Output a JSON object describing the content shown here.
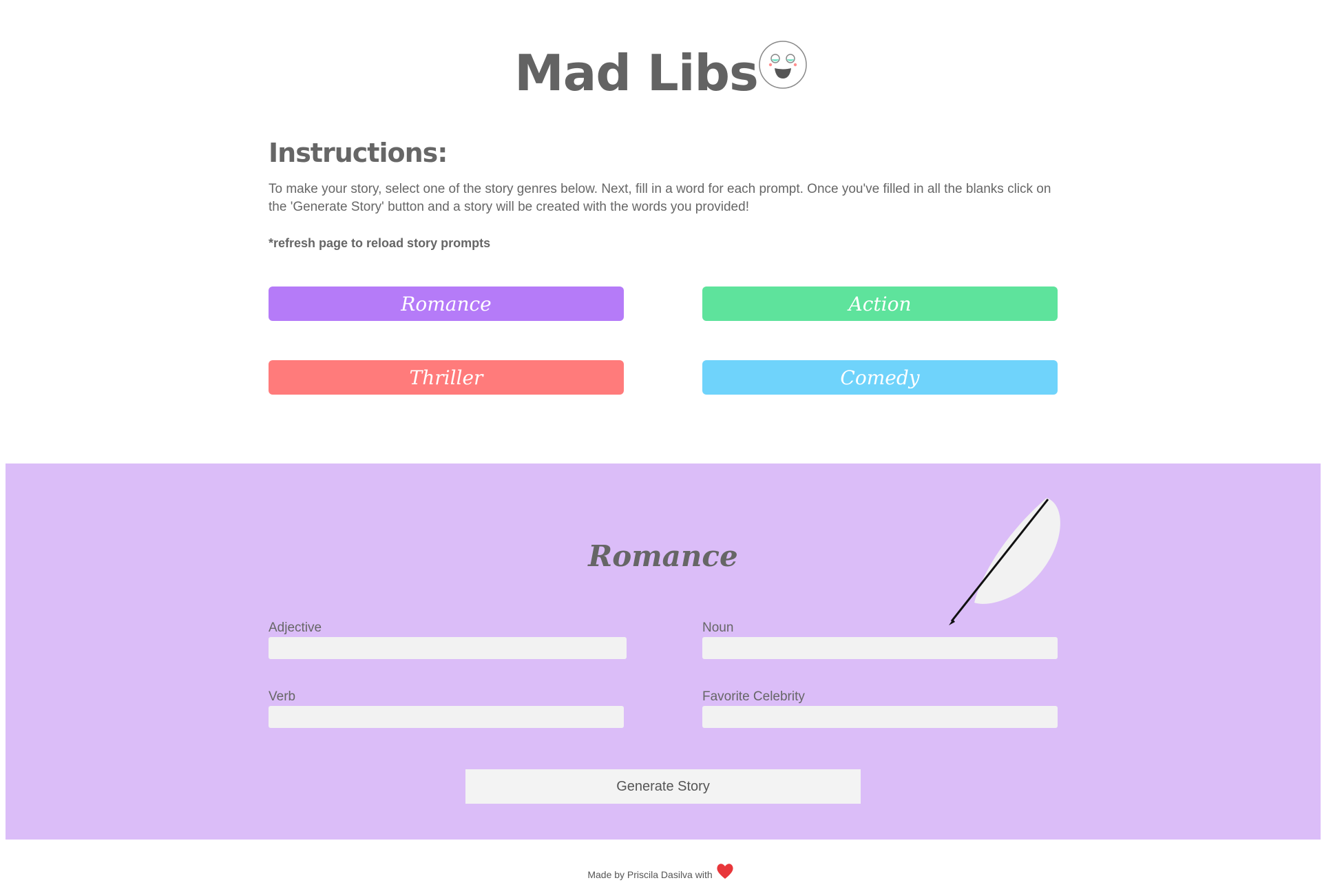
{
  "header": {
    "title": "Mad Libs",
    "mascot_icon": "smiley-face-icon"
  },
  "instructions": {
    "heading": "Instructions:",
    "body": "To make your story, select one of the story genres below. Next, fill in a word for each prompt. Once you've filled in all the blanks click on the 'Generate Story' button and a story will be created with the words you provided!",
    "note": "*refresh page to reload story prompts"
  },
  "genres": {
    "romance": "Romance",
    "action": "Action",
    "thriller": "Thriller",
    "comedy": "Comedy"
  },
  "colors": {
    "romance": "#b57bf8",
    "action": "#5ee39c",
    "thriller": "#ff7b7b",
    "comedy": "#6fd3fb",
    "story_background": "#dbbdf8"
  },
  "story": {
    "title": "Romance",
    "decor_icon": "quill-feather-icon",
    "fields": {
      "adjective": {
        "label": "Adjective",
        "value": ""
      },
      "noun": {
        "label": "Noun",
        "value": ""
      },
      "verb": {
        "label": "Verb",
        "value": ""
      },
      "celebrity": {
        "label": "Favorite Celebrity",
        "value": ""
      }
    },
    "generate_label": "Generate Story"
  },
  "footer": {
    "text": "Made by Priscila Dasilva with",
    "heart_icon": "heart-icon"
  }
}
